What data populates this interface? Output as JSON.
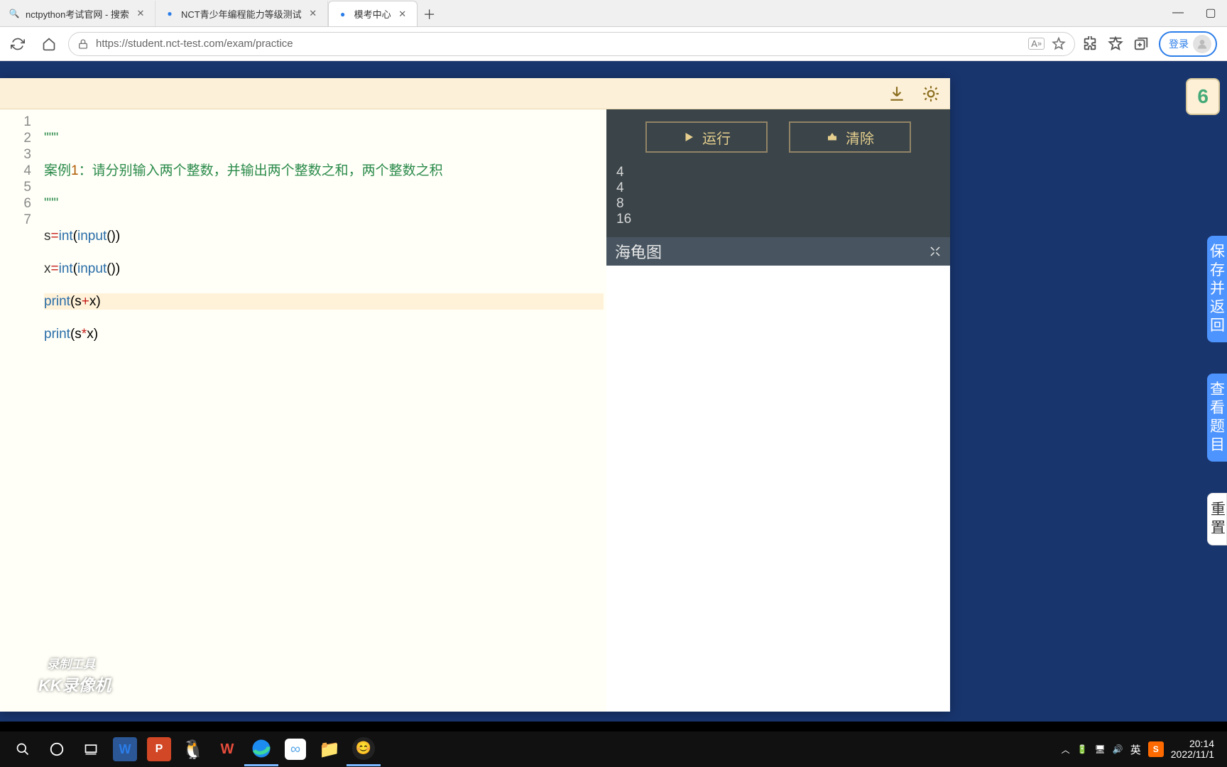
{
  "browser": {
    "tabs": [
      {
        "title": "nctpython考试官网 - 搜索",
        "icon": "🔍",
        "active": false
      },
      {
        "title": "NCT青少年编程能力等级测试",
        "icon": "●",
        "active": false
      },
      {
        "title": "模考中心",
        "icon": "●",
        "active": true
      }
    ],
    "url": "https://student.nct-test.com/exam/practice",
    "login": "登录"
  },
  "ide": {
    "top_badge": "6",
    "toolbar": {
      "download": "⭳",
      "theme": "☀"
    },
    "code_lines": [
      {
        "raw": "\"\"\"",
        "type": "str"
      },
      {
        "raw": "案例1：请分别输入两个整数，并输出两个整数之和，两个整数之积",
        "type": "str",
        "prefix_num": "1"
      },
      {
        "raw": "\"\"\"",
        "type": "str"
      },
      {
        "raw": "s=int(input())",
        "type": "code"
      },
      {
        "raw": "x=int(input())",
        "type": "code"
      },
      {
        "raw": "print(s+x)",
        "type": "code",
        "hl": true
      },
      {
        "raw": "print(s*x)",
        "type": "code"
      }
    ],
    "run_label": "运行",
    "clear_label": "清除",
    "console": [
      "4",
      "4",
      "8",
      "16"
    ],
    "turtle_title": "海龟图"
  },
  "side": {
    "save": "保存并返回",
    "view": "查看题目",
    "reset": "重置"
  },
  "watermark": {
    "top": "录制工具",
    "bottom": "KK录像机"
  },
  "taskbar": {
    "time": "20:14",
    "date": "2022/11/1",
    "ime": "英"
  }
}
